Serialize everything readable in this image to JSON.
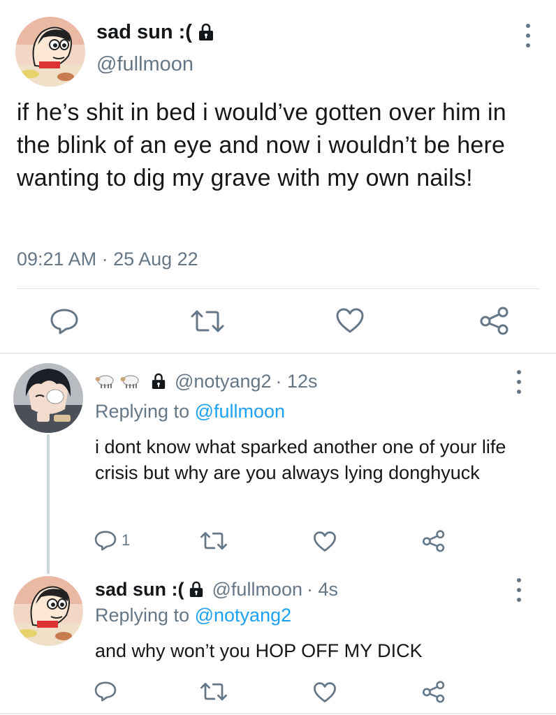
{
  "main_tweet": {
    "display_name": "sad sun :(",
    "handle": "@fullmoon",
    "text": "if he’s shit in bed i would’ve gotten over him in the blink of an eye and now i wouldn’t be here wanting to dig my grave with my own nails!",
    "timestamp": "09:21 AM · 25 Aug 22",
    "actions": [
      {
        "icon": "reply-icon",
        "count": ""
      },
      {
        "icon": "retweet-icon",
        "count": ""
      },
      {
        "icon": "like-icon",
        "count": ""
      },
      {
        "icon": "share-icon",
        "count": ""
      }
    ]
  },
  "replies": [
    {
      "display_name_emoji": "🐑🐑",
      "handle": "@notyang2",
      "time": "· 12s",
      "replying_prefix": "Replying to",
      "replying_to": "@fullmoon",
      "text": "i dont know what sparked another one of your life crisis but why are you always lying donghyuck",
      "reply_count": "1"
    },
    {
      "display_name": "sad sun :(",
      "handle": "@fullmoon",
      "time": "· 4s",
      "replying_prefix": "Replying to",
      "replying_to": "@notyang2",
      "text": "and why won’t you HOP OFF MY DICK",
      "reply_count": ""
    }
  ],
  "colors": {
    "text": "#14171a",
    "secondary": "#657786",
    "link": "#1da1f2",
    "divider": "#e1e8ed"
  }
}
